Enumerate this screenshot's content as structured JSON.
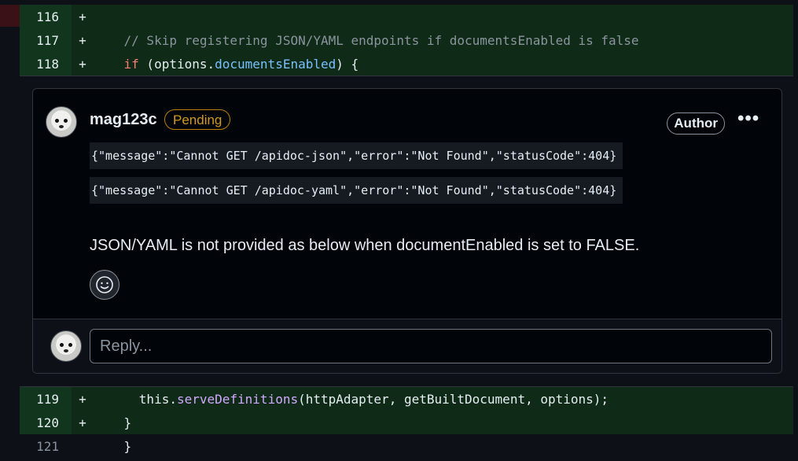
{
  "diff_top": [
    {
      "line": "116",
      "sign": "+",
      "tokens": []
    },
    {
      "line": "117",
      "sign": "+",
      "tokens": [
        {
          "t": "    ",
          "c": "plain"
        },
        {
          "t": "// Skip registering JSON/YAML endpoints if documentsEnabled is false",
          "c": "comment"
        }
      ]
    },
    {
      "line": "118",
      "sign": "+",
      "tokens": [
        {
          "t": "    ",
          "c": "plain"
        },
        {
          "t": "if",
          "c": "kw"
        },
        {
          "t": " (options.",
          "c": "plain"
        },
        {
          "t": "documentsEnabled",
          "c": "prop"
        },
        {
          "t": ") {",
          "c": "plain"
        }
      ]
    }
  ],
  "diff_bottom": [
    {
      "line": "119",
      "sign": "+",
      "type": "add",
      "tokens": [
        {
          "t": "      this.",
          "c": "plain"
        },
        {
          "t": "serveDefinitions",
          "c": "fn"
        },
        {
          "t": "(httpAdapter, getBuiltDocument, options);",
          "c": "plain"
        }
      ]
    },
    {
      "line": "120",
      "sign": "+",
      "type": "add",
      "tokens": [
        {
          "t": "    }",
          "c": "plain"
        }
      ]
    },
    {
      "line": "121",
      "sign": "",
      "type": "ctx",
      "tokens": [
        {
          "t": "    }",
          "c": "plain"
        }
      ]
    }
  ],
  "comment": {
    "author": "mag123c",
    "status": "Pending",
    "role_badge": "Author",
    "more_label": "•••",
    "code_lines": [
      "{\"message\":\"Cannot GET /apidoc-json\",\"error\":\"Not Found\",\"statusCode\":404}",
      "{\"message\":\"Cannot GET /apidoc-yaml\",\"error\":\"Not Found\",\"statusCode\":404}"
    ],
    "body": "JSON/YAML is not provided as below when documentEnabled is set to FALSE."
  },
  "reply": {
    "placeholder": "Reply..."
  },
  "colors": {
    "added_bg": "#0f2b17",
    "added_gutter": "#12361d",
    "pending": "#d29922"
  },
  "icons": [
    "avatar",
    "smiley-icon",
    "kebab-menu-icon"
  ]
}
